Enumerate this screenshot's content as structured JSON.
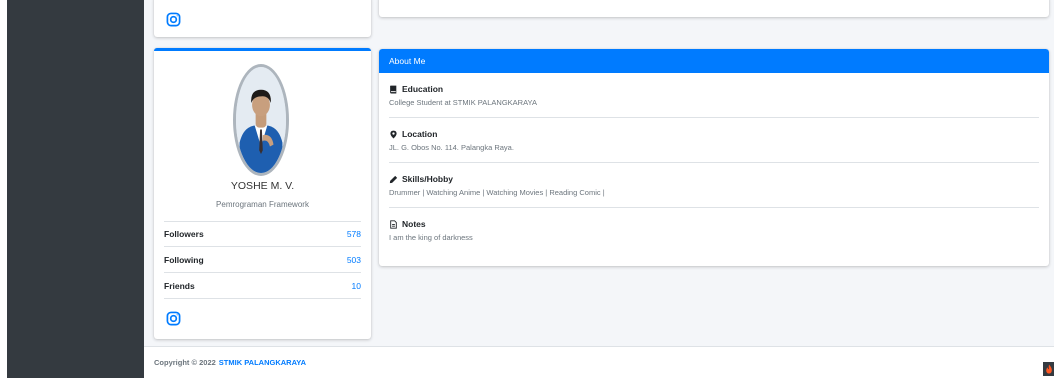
{
  "profile": {
    "name": "YOSHE M. V.",
    "subtitle": "Pemrograman Framework",
    "stats": [
      {
        "label": "Followers",
        "value": "578"
      },
      {
        "label": "Following",
        "value": "503"
      },
      {
        "label": "Friends",
        "value": "10"
      }
    ],
    "social_icon": "instagram-icon"
  },
  "about": {
    "header": "About Me",
    "items": [
      {
        "icon": "book-icon",
        "title": "Education",
        "text": "College Student at STMIK PALANGKARAYA"
      },
      {
        "icon": "map-marker-icon",
        "title": "Location",
        "text": "JL. G. Obos No. 114. Palangka Raya."
      },
      {
        "icon": "pencil-icon",
        "title": "Skills/Hobby",
        "text": "Drummer | Watching Anime | Watching Movies | Reading Comic |"
      },
      {
        "icon": "file-icon",
        "title": "Notes",
        "text": "I am the king of darkness"
      }
    ]
  },
  "footer": {
    "prefix": "Copyright © 2022",
    "link": "STMIK PALANGKARAYA"
  },
  "colors": {
    "primary": "#007bff",
    "sidebar": "#343a40",
    "content_bg": "#f4f6f9",
    "badge_accent": "#ff5722"
  }
}
